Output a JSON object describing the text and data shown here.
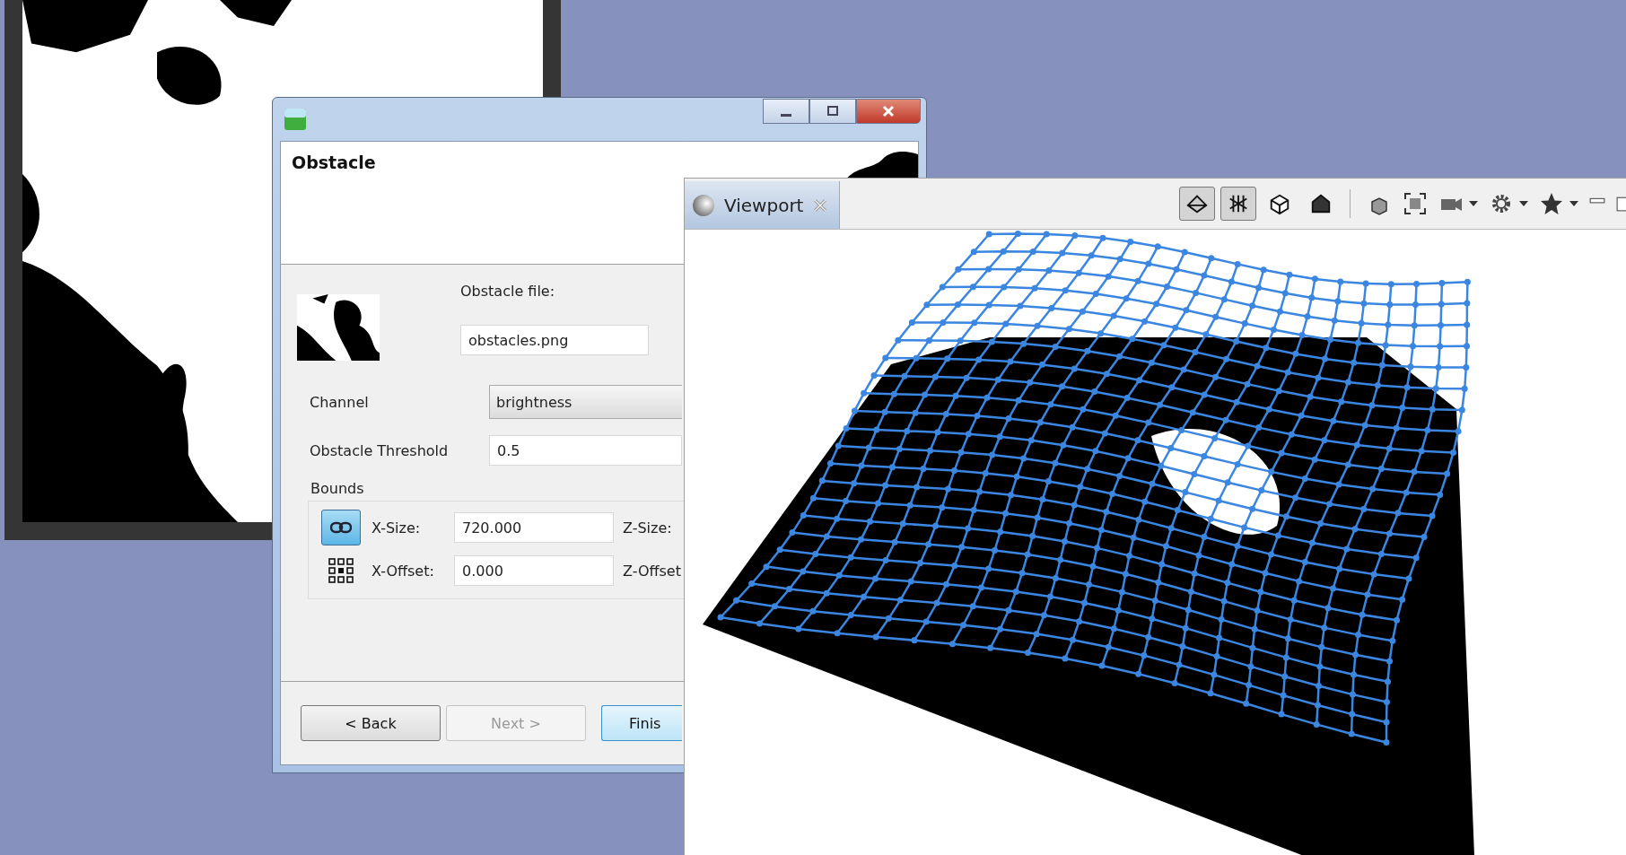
{
  "dialog": {
    "header": {
      "title": "Obstacle"
    },
    "obstacle_file": {
      "label": "Obstacle file:",
      "value": "obstacles.png"
    },
    "channel": {
      "label": "Channel",
      "value": "brightness"
    },
    "threshold": {
      "label": "Obstacle Threshold",
      "value": "0.5"
    },
    "bounds": {
      "title": "Bounds",
      "rows": [
        {
          "kind": "link",
          "on": true,
          "label": "X-Size:",
          "value": "720.000",
          "label_2": "Z-Size:"
        },
        {
          "kind": "anchor",
          "label": "X-Offset:",
          "value": "0.000",
          "label_2": "Z-Offset"
        }
      ]
    },
    "buttons": [
      {
        "label": "< Back",
        "disabled": false,
        "default": false
      },
      {
        "label": "Next >",
        "disabled": true,
        "default": false
      },
      {
        "label": "Finis",
        "disabled": false,
        "default": true
      }
    ]
  },
  "viewport": {
    "tab": {
      "label": "Viewport",
      "selected": true
    },
    "view_modes": [
      {
        "selected": true
      },
      {
        "selected": true
      },
      {
        "selected": false
      },
      {
        "selected": false
      }
    ]
  }
}
